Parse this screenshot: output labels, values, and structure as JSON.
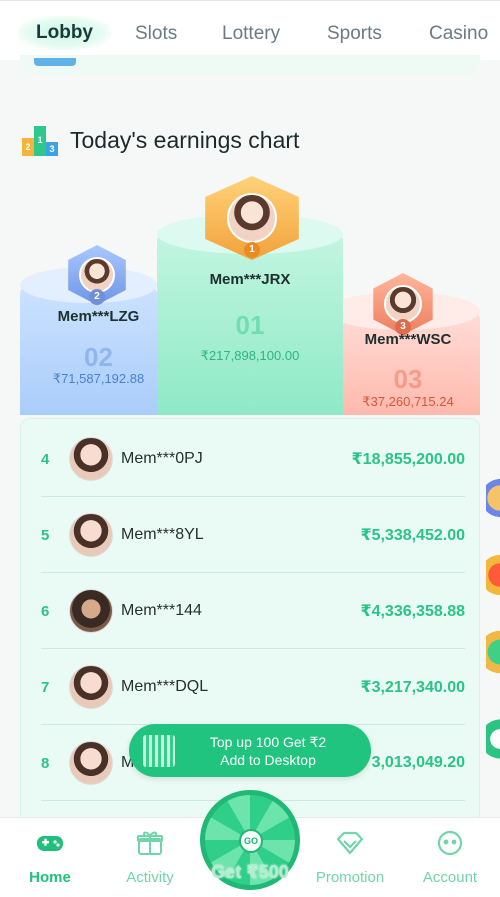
{
  "tabs": [
    {
      "label": "Lobby",
      "active": true
    },
    {
      "label": "Slots"
    },
    {
      "label": "Lottery"
    },
    {
      "label": "Sports"
    },
    {
      "label": "Casino"
    }
  ],
  "section": {
    "title": "Today's earnings chart",
    "icon": "podium-icon"
  },
  "podium": {
    "first": {
      "rank": "1",
      "name": "Mem***JRX",
      "big": "01",
      "amount": "₹217,898,100.00"
    },
    "second": {
      "rank": "2",
      "name": "Mem***LZG",
      "big": "02",
      "amount": "₹71,587,192.88"
    },
    "third": {
      "rank": "3",
      "name": "Mem***WSC",
      "big": "03",
      "amount": "₹37,260,715.24"
    }
  },
  "rankings": [
    {
      "rank": "4",
      "name": "Mem***0PJ",
      "amount": "₹18,855,200.00"
    },
    {
      "rank": "5",
      "name": "Mem***8YL",
      "amount": "₹5,338,452.00"
    },
    {
      "rank": "6",
      "name": "Mem***144",
      "amount": "₹4,336,358.88"
    },
    {
      "rank": "7",
      "name": "Mem***DQL",
      "amount": "₹3,217,340.00"
    },
    {
      "rank": "8",
      "name": "M",
      "amount": "3,013,049.20"
    }
  ],
  "topup": {
    "line1": "Top up 100 Get ₹2",
    "line2": "Add to Desktop"
  },
  "wheel": {
    "go": "GO",
    "label": "Get ₹500"
  },
  "nav": [
    {
      "label": "Home",
      "icon": "gamepad-icon",
      "active": true
    },
    {
      "label": "Activity",
      "icon": "gift-icon"
    },
    {
      "label": "Promotion",
      "icon": "diamond-icon"
    },
    {
      "label": "Account",
      "icon": "account-face-icon"
    }
  ],
  "colors": {
    "accent": "#21c47e",
    "rank_text": "#29c488",
    "first": "#f2a23a",
    "second": "#6f95e6",
    "third": "#ee7e5e"
  }
}
